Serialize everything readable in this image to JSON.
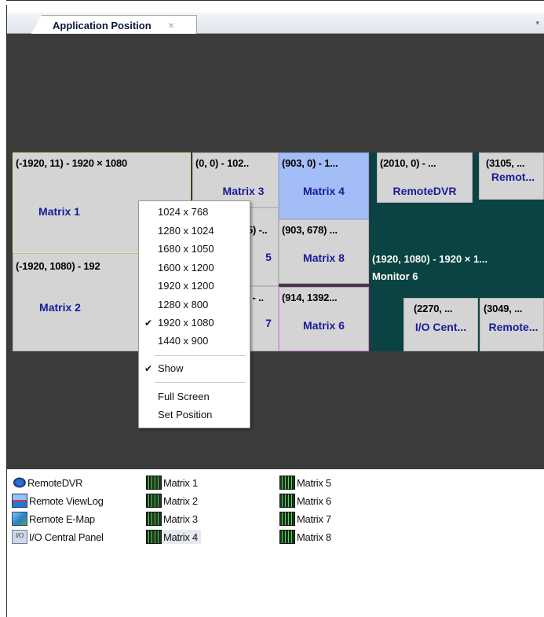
{
  "tab": {
    "label": "Application Position",
    "close": "×",
    "menu": "▾"
  },
  "screens": [
    {
      "coord": "(-1920, 11) - 1920 × 1080",
      "name": "Matrix 1"
    },
    {
      "coord": "(0, 0) - 102..",
      "name": "Matrix 3"
    },
    {
      "coord": "(903, 0) - 1...",
      "name": "Matrix 4"
    },
    {
      "coord": "5) -..",
      "name": "5"
    },
    {
      "coord": "(903, 678) ...",
      "name": "Matrix 8"
    },
    {
      "coord": "(-1920, 1080) - 192",
      "name": "Matrix 2"
    },
    {
      "coord": ") - ..",
      "name": "7"
    },
    {
      "coord": "(914, 1392...",
      "name": "Matrix 6"
    }
  ],
  "monitor": {
    "coord": "(1920, 1080) - 1920 × 1...",
    "name": "Monitor 6",
    "cards": [
      {
        "coord": "(2010, 0) - ...",
        "name": "RemoteDVR"
      },
      {
        "coord": "(3105, ...",
        "name": "Remot..."
      },
      {
        "coord": "(2270, ...",
        "name": "I/O Cent..."
      },
      {
        "coord": "(3049, ...",
        "name": "Remote..."
      }
    ]
  },
  "context_menu": {
    "resolutions": [
      "1024 x 768",
      "1280 x 1024",
      "1680 x 1050",
      "1600 x 1200",
      "1920 x 1200",
      "1280 x 800",
      "1920 x 1080",
      "1440 x 900"
    ],
    "checked_resolution": "1920 x 1080",
    "check": "✔",
    "show": "Show",
    "full_screen": "Full Screen",
    "set_position": "Set Position"
  },
  "apps": [
    {
      "label": "RemoteDVR",
      "icon": "eye-icon"
    },
    {
      "label": "Remote ViewLog",
      "icon": "viewlog-icon"
    },
    {
      "label": "Remote E-Map",
      "icon": "emap-icon"
    },
    {
      "label": "I/O Central Panel",
      "icon": "io-panel-icon",
      "icon_text": "I/O"
    }
  ],
  "matrices": [
    "Matrix 1",
    "Matrix 2",
    "Matrix 3",
    "Matrix 4",
    "Matrix 5",
    "Matrix 6",
    "Matrix 7",
    "Matrix 8"
  ]
}
